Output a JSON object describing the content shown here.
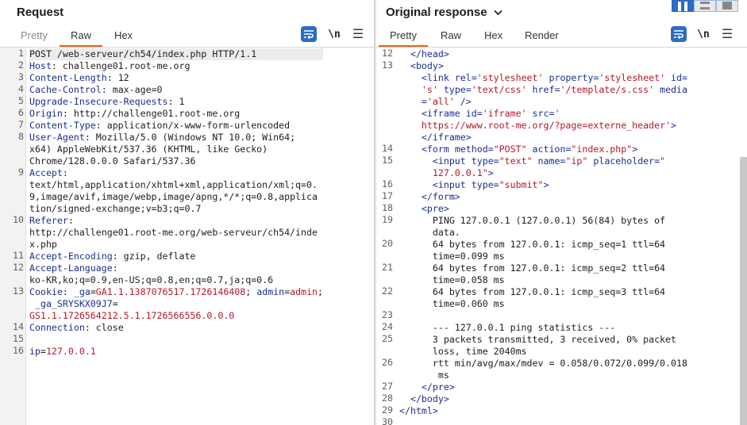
{
  "request": {
    "title": "Request",
    "tabs": [
      "Pretty",
      "Raw",
      "Hex"
    ],
    "active_tab": "Raw",
    "newline_label": "\\n",
    "lines": [
      {
        "n": "1",
        "parts": [
          [
            "hval",
            "POST /web-serveur/ch54/index.php HTTP/1.1"
          ]
        ]
      },
      {
        "n": "2",
        "parts": [
          [
            "hname",
            "Host"
          ],
          [
            "hval",
            ": challenge01.root-me.org"
          ]
        ]
      },
      {
        "n": "3",
        "parts": [
          [
            "hname",
            "Content-Length"
          ],
          [
            "hval",
            ": 12"
          ]
        ]
      },
      {
        "n": "4",
        "parts": [
          [
            "hname",
            "Cache-Control"
          ],
          [
            "hval",
            ": max-age=0"
          ]
        ]
      },
      {
        "n": "5",
        "parts": [
          [
            "hname",
            "Upgrade-Insecure-Requests"
          ],
          [
            "hval",
            ": 1"
          ]
        ]
      },
      {
        "n": "6",
        "parts": [
          [
            "hname",
            "Origin"
          ],
          [
            "hval",
            ": http://challenge01.root-me.org"
          ]
        ]
      },
      {
        "n": "7",
        "parts": [
          [
            "hname",
            "Content-Type"
          ],
          [
            "hval",
            ": application/x-www-form-urlencoded"
          ]
        ]
      },
      {
        "n": "8",
        "parts": [
          [
            "hname",
            "User-Agent"
          ],
          [
            "hval",
            ": Mozilla/5.0 (Windows NT 10.0; Win64;"
          ]
        ]
      },
      {
        "n": "",
        "parts": [
          [
            "hval",
            "x64) AppleWebKit/537.36 (KHTML, like Gecko)"
          ]
        ]
      },
      {
        "n": "",
        "parts": [
          [
            "hval",
            "Chrome/128.0.0.0 Safari/537.36"
          ]
        ]
      },
      {
        "n": "9",
        "parts": [
          [
            "hname",
            "Accept"
          ],
          [
            "hval",
            ":"
          ]
        ]
      },
      {
        "n": "",
        "parts": [
          [
            "hval",
            "text/html,application/xhtml+xml,application/xml;q=0."
          ]
        ]
      },
      {
        "n": "",
        "parts": [
          [
            "hval",
            "9,image/avif,image/webp,image/apng,*/*;q=0.8,applica"
          ]
        ]
      },
      {
        "n": "",
        "parts": [
          [
            "hval",
            "tion/signed-exchange;v=b3;q=0.7"
          ]
        ]
      },
      {
        "n": "10",
        "parts": [
          [
            "hname",
            "Referer"
          ],
          [
            "hval",
            ":"
          ]
        ]
      },
      {
        "n": "",
        "parts": [
          [
            "hval",
            "http://challenge01.root-me.org/web-serveur/ch54/inde"
          ]
        ]
      },
      {
        "n": "",
        "parts": [
          [
            "hval",
            "x.php"
          ]
        ]
      },
      {
        "n": "11",
        "parts": [
          [
            "hname",
            "Accept-Encoding"
          ],
          [
            "hval",
            ": gzip, deflate"
          ]
        ]
      },
      {
        "n": "12",
        "parts": [
          [
            "hname",
            "Accept-Language"
          ],
          [
            "hval",
            ":"
          ]
        ]
      },
      {
        "n": "",
        "parts": [
          [
            "hval",
            "ko-KR,ko;q=0.9,en-US;q=0.8,en;q=0.7,ja;q=0.6"
          ]
        ]
      },
      {
        "n": "13",
        "parts": [
          [
            "hname",
            "Cookie"
          ],
          [
            "hval",
            ": "
          ],
          [
            "hname",
            "_ga"
          ],
          [
            "hval",
            "="
          ],
          [
            "red",
            "GA1.1.1387076517.1726146408"
          ],
          [
            "hval",
            "; "
          ],
          [
            "hname",
            "admin"
          ],
          [
            "hval",
            "="
          ],
          [
            "red",
            "admin"
          ],
          [
            "hval",
            ";"
          ]
        ]
      },
      {
        "n": "",
        "parts": [
          [
            "hval",
            " "
          ],
          [
            "hname",
            "_ga_SRYSKX09J7"
          ],
          [
            "hval",
            "="
          ]
        ]
      },
      {
        "n": "",
        "parts": [
          [
            "red",
            "GS1.1.1726564212.5.1.1726566556.0.0.0"
          ]
        ]
      },
      {
        "n": "14",
        "parts": [
          [
            "hname",
            "Connection"
          ],
          [
            "hval",
            ": close"
          ]
        ]
      },
      {
        "n": "15",
        "parts": [
          [
            "hval",
            ""
          ]
        ]
      },
      {
        "n": "16",
        "parts": [
          [
            "hname",
            "ip"
          ],
          [
            "hval",
            "="
          ],
          [
            "red",
            "127.0.0.1"
          ]
        ]
      }
    ]
  },
  "response": {
    "title": "Original response",
    "tabs": [
      "Pretty",
      "Raw",
      "Hex",
      "Render"
    ],
    "active_tab": "Pretty",
    "newline_label": "\\n",
    "lines": [
      {
        "n": "12",
        "parts": [
          [
            "txt",
            "  "
          ],
          [
            "tag",
            "</head>"
          ]
        ]
      },
      {
        "n": "13",
        "parts": [
          [
            "txt",
            "  "
          ],
          [
            "tag",
            "<body>"
          ]
        ]
      },
      {
        "n": "",
        "parts": [
          [
            "txt",
            "    "
          ],
          [
            "tag",
            "<link "
          ],
          [
            "attr",
            "rel="
          ],
          [
            "aval",
            "'stylesheet'"
          ],
          [
            "attr",
            " property="
          ],
          [
            "aval",
            "'stylesheet'"
          ],
          [
            "attr",
            " id="
          ]
        ]
      },
      {
        "n": "",
        "parts": [
          [
            "txt",
            "    "
          ],
          [
            "aval",
            "'s'"
          ],
          [
            "attr",
            " type="
          ],
          [
            "aval",
            "'text/css'"
          ],
          [
            "attr",
            " href="
          ],
          [
            "aval",
            "'/template/s.css'"
          ],
          [
            "attr",
            " media"
          ]
        ]
      },
      {
        "n": "",
        "parts": [
          [
            "txt",
            "    "
          ],
          [
            "attr",
            "="
          ],
          [
            "aval",
            "'all'"
          ],
          [
            "tag",
            " />"
          ]
        ]
      },
      {
        "n": "",
        "parts": [
          [
            "txt",
            "    "
          ],
          [
            "tag",
            "<iframe "
          ],
          [
            "attr",
            "id="
          ],
          [
            "aval",
            "'iframe'"
          ],
          [
            "attr",
            " src="
          ],
          [
            "aval",
            "'"
          ]
        ]
      },
      {
        "n": "",
        "parts": [
          [
            "txt",
            "    "
          ],
          [
            "aval",
            "https://www.root-me.org/?page=externe_header'"
          ],
          [
            "tag",
            ">"
          ]
        ]
      },
      {
        "n": "",
        "parts": [
          [
            "txt",
            "    "
          ],
          [
            "tag",
            "</iframe>"
          ]
        ]
      },
      {
        "n": "14",
        "parts": [
          [
            "txt",
            "    "
          ],
          [
            "tag",
            "<form "
          ],
          [
            "attr",
            "method="
          ],
          [
            "aval",
            "\"POST\""
          ],
          [
            "attr",
            " action="
          ],
          [
            "aval",
            "\"index.php\""
          ],
          [
            "tag",
            ">"
          ]
        ]
      },
      {
        "n": "15",
        "parts": [
          [
            "txt",
            "      "
          ],
          [
            "tag",
            "<input "
          ],
          [
            "attr",
            "type="
          ],
          [
            "aval",
            "\"text\""
          ],
          [
            "attr",
            " name="
          ],
          [
            "aval",
            "\"ip\""
          ],
          [
            "attr",
            " placeholder="
          ],
          [
            "aval",
            "\""
          ]
        ]
      },
      {
        "n": "",
        "parts": [
          [
            "txt",
            "      "
          ],
          [
            "aval",
            "127.0.0.1\""
          ],
          [
            "tag",
            ">"
          ]
        ]
      },
      {
        "n": "16",
        "parts": [
          [
            "txt",
            "      "
          ],
          [
            "tag",
            "<input "
          ],
          [
            "attr",
            "type="
          ],
          [
            "aval",
            "\"submit\""
          ],
          [
            "tag",
            ">"
          ]
        ]
      },
      {
        "n": "17",
        "parts": [
          [
            "txt",
            "    "
          ],
          [
            "tag",
            "</form>"
          ]
        ]
      },
      {
        "n": "18",
        "parts": [
          [
            "txt",
            "    "
          ],
          [
            "tag",
            "<pre>"
          ]
        ]
      },
      {
        "n": "19",
        "parts": [
          [
            "txt",
            "      PING 127.0.0.1 (127.0.0.1) 56(84) bytes of"
          ]
        ]
      },
      {
        "n": "",
        "parts": [
          [
            "txt",
            "      data."
          ]
        ]
      },
      {
        "n": "20",
        "parts": [
          [
            "txt",
            "      64 bytes from 127.0.0.1: icmp_seq=1 ttl=64"
          ]
        ]
      },
      {
        "n": "",
        "parts": [
          [
            "txt",
            "      time=0.099 ms"
          ]
        ]
      },
      {
        "n": "21",
        "parts": [
          [
            "txt",
            "      64 bytes from 127.0.0.1: icmp_seq=2 ttl=64"
          ]
        ]
      },
      {
        "n": "",
        "parts": [
          [
            "txt",
            "      time=0.058 ms"
          ]
        ]
      },
      {
        "n": "22",
        "parts": [
          [
            "txt",
            "      64 bytes from 127.0.0.1: icmp_seq=3 ttl=64"
          ]
        ]
      },
      {
        "n": "",
        "parts": [
          [
            "txt",
            "      time=0.060 ms"
          ]
        ]
      },
      {
        "n": "23",
        "parts": [
          [
            "txt",
            ""
          ]
        ]
      },
      {
        "n": "24",
        "parts": [
          [
            "txt",
            "      --- 127.0.0.1 ping statistics ---"
          ]
        ]
      },
      {
        "n": "25",
        "parts": [
          [
            "txt",
            "      3 packets transmitted, 3 received, 0% packet"
          ]
        ]
      },
      {
        "n": "",
        "parts": [
          [
            "txt",
            "      loss, time 2040ms"
          ]
        ]
      },
      {
        "n": "26",
        "parts": [
          [
            "txt",
            "      rtt min/avg/max/mdev = 0.058/0.072/0.099/0.018"
          ]
        ]
      },
      {
        "n": "",
        "parts": [
          [
            "txt",
            "       ms"
          ]
        ]
      },
      {
        "n": "27",
        "parts": [
          [
            "txt",
            "    "
          ],
          [
            "tag",
            "</pre>"
          ]
        ]
      },
      {
        "n": "28",
        "parts": [
          [
            "txt",
            "  "
          ],
          [
            "tag",
            "</body>"
          ]
        ]
      },
      {
        "n": "29",
        "parts": [
          [
            "tag",
            "</html>"
          ]
        ]
      },
      {
        "n": "30",
        "parts": [
          [
            "txt",
            ""
          ]
        ]
      }
    ]
  },
  "icons": {
    "wrap": "word-wrap-icon",
    "menu": "hamburger-menu-icon",
    "caret": "chevron-down-icon",
    "layout": [
      "layout-side-by-side-icon",
      "layout-stacked-icon",
      "layout-single-icon"
    ]
  },
  "colors": {
    "accent_tab": "#e8621a",
    "button_blue": "#2b6cc6",
    "header_name": "#1a2f8f",
    "value_red": "#b5172a"
  }
}
